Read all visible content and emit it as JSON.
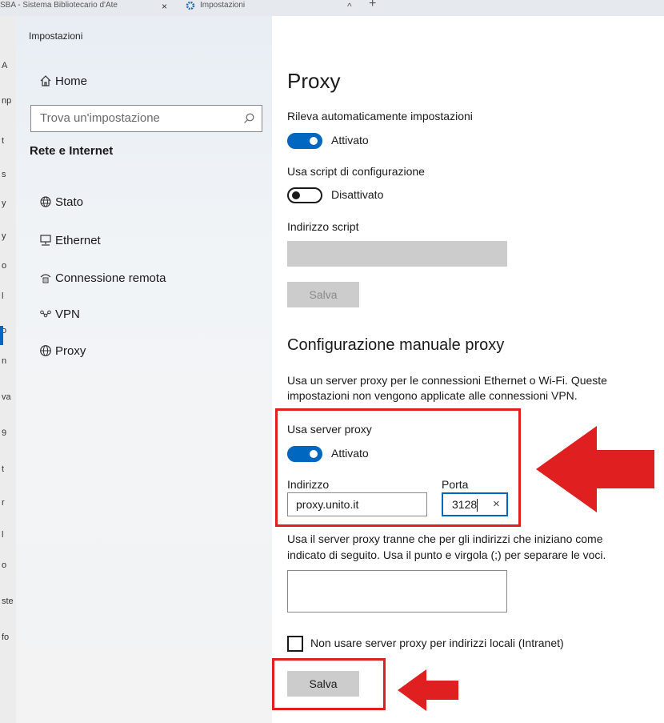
{
  "browser": {
    "tab1_title": "SBA - Sistema Bibliotecario d'Ate",
    "tab1_close": "×",
    "tab2_title": "Impostazioni",
    "tab2_caret": "^",
    "new_tab": "+",
    "behind_glyphs": [
      "A",
      "np",
      "t",
      "s",
      "y",
      "y",
      "o",
      "l",
      "o",
      "n",
      "va",
      "9",
      "t",
      "r",
      "l",
      "o",
      "ste",
      "fo"
    ]
  },
  "window": {
    "title": "Impostazioni"
  },
  "sidebar": {
    "home_label": "Home",
    "search_placeholder": "Trova un'impostazione",
    "section_heading": "Rete e Internet",
    "items": [
      {
        "label": "Stato",
        "icon": "globe-status-icon"
      },
      {
        "label": "Ethernet",
        "icon": "ethernet-icon"
      },
      {
        "label": "Connessione remota",
        "icon": "dialup-icon"
      },
      {
        "label": "VPN",
        "icon": "vpn-icon"
      },
      {
        "label": "Proxy",
        "icon": "globe-icon",
        "selected": true
      }
    ]
  },
  "main": {
    "title": "Proxy",
    "auto": {
      "heading": "Rileva automaticamente impostazioni",
      "toggle_state": "Attivato",
      "on": true
    },
    "script": {
      "heading": "Usa script di configurazione",
      "toggle_state": "Disattivato",
      "on": false
    },
    "script_address_label": "Indirizzo script",
    "save_label_1": "Salva",
    "manual": {
      "title": "Configurazione manuale proxy",
      "description_line1": "Usa un server proxy per le connessioni Ethernet o Wi-Fi. Queste",
      "description_line2": "impostazioni non vengono applicate alle connessioni VPN.",
      "use_proxy_heading": "Usa server proxy",
      "use_proxy_state": "Attivato",
      "use_proxy_on": true,
      "address_label": "Indirizzo",
      "address_value": "proxy.unito.it",
      "port_label": "Porta",
      "port_value": "3128",
      "clear_glyph": "×",
      "exceptions_line1": "Usa il server proxy tranne che per gli indirizzi che iniziano come",
      "exceptions_line2": "indicato di seguito. Usa il punto e virgola (;) per separare le voci.",
      "exceptions_value": "",
      "local_checkbox_label": "Non usare server proxy per indirizzi locali (Intranet)",
      "local_checked": false,
      "save_label_2": "Salva"
    }
  },
  "colors": {
    "accent": "#0067c0",
    "annotation_red": "#e02020",
    "disabled_gray": "#cccccc"
  }
}
